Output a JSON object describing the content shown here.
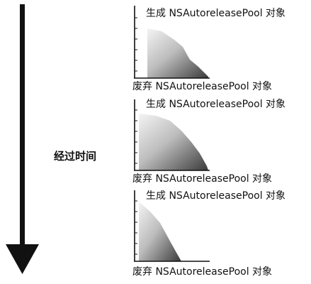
{
  "time_label": "经过时间",
  "panels": [
    {
      "top_label": "生成 NSAutoreleasePool 对象",
      "bottom_label": "废弃 NSAutoreleasePool 对象"
    },
    {
      "top_label": "生成 NSAutoreleasePool 对象",
      "bottom_label": "废弃 NSAutoreleasePool 对象"
    },
    {
      "top_label": "生成 NSAutoreleasePool 对象",
      "bottom_label": "废弃 NSAutoreleasePool 对象"
    }
  ],
  "colors": {
    "arrow": "#111111",
    "axis": "#111111",
    "gradient_light": "#f4f4f4",
    "gradient_dark": "#3a3a3a"
  }
}
